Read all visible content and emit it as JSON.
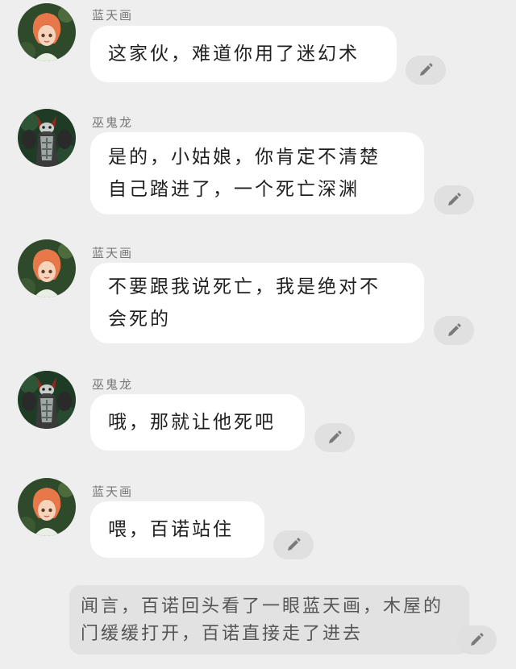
{
  "characters": {
    "girl": {
      "name": "蓝天画",
      "icon": "red-haired-girl-avatar"
    },
    "dragon": {
      "name": "巫鬼龙",
      "icon": "armored-dragon-avatar"
    }
  },
  "messages": [
    {
      "speaker": "girl",
      "text": "这家伙，难道你用了迷幻术"
    },
    {
      "speaker": "dragon",
      "text": "是的，小姑娘，你肯定不清楚\n自己踏进了，一个死亡深渊"
    },
    {
      "speaker": "girl",
      "text": "不要跟我说死亡，我是绝对不\n会死的"
    },
    {
      "speaker": "dragon",
      "text": "哦，那就让他死吧"
    },
    {
      "speaker": "girl",
      "text": "喂，百诺站住"
    }
  ],
  "narration": {
    "text": "闻言，百诺回头看了一眼蓝天画，木屋的门缓缓打开，百诺直接走了进去"
  },
  "icons": {
    "edit": "pencil-edit-icon"
  },
  "colors": {
    "background": "#eeeeee",
    "bubble": "#ffffff",
    "narration_bg": "#e2e2e2",
    "edit_button": "#e0e0e0"
  }
}
